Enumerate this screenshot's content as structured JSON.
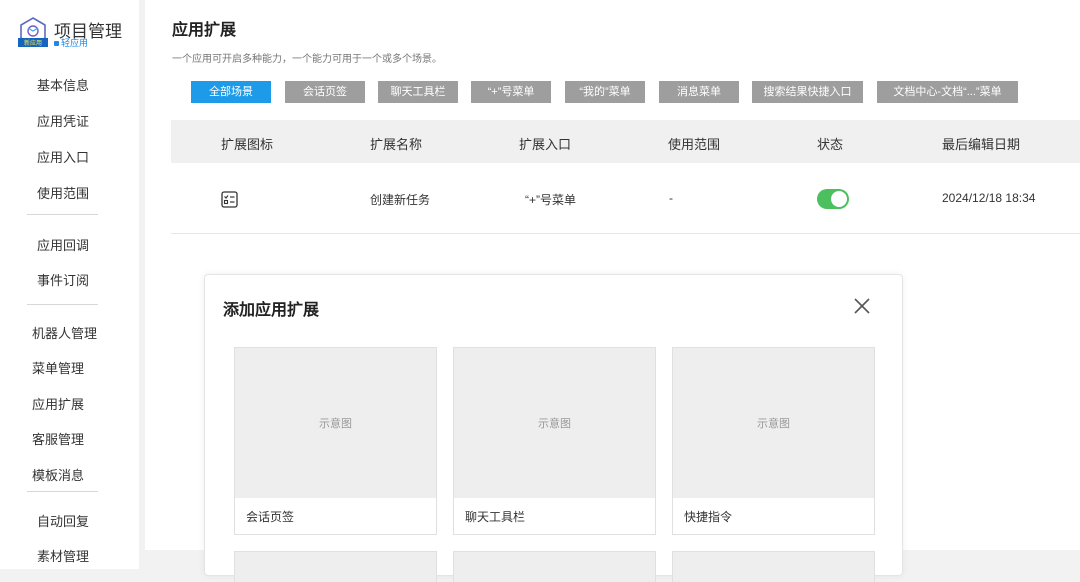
{
  "app": {
    "title": "项目管理",
    "subtitle": "轻应用",
    "logo_text": "新应用"
  },
  "sidebar": {
    "items": [
      {
        "label": "基本信息"
      },
      {
        "label": "应用凭证"
      },
      {
        "label": "应用入口"
      },
      {
        "label": "使用范围"
      },
      {
        "label": "应用回调"
      },
      {
        "label": "事件订阅"
      },
      {
        "label": "机器人管理"
      },
      {
        "label": "菜单管理"
      },
      {
        "label": "应用扩展"
      },
      {
        "label": "客服管理"
      },
      {
        "label": "模板消息"
      },
      {
        "label": "自动回复"
      },
      {
        "label": "素材管理"
      }
    ]
  },
  "main": {
    "title": "应用扩展",
    "description": "一个应用可开启多种能力，一个能力可用于一个或多个场景。",
    "filters": [
      {
        "label": "全部场景",
        "active": true
      },
      {
        "label": "会话页签"
      },
      {
        "label": "聊天工具栏"
      },
      {
        "label": "“+”号菜单"
      },
      {
        "label": "“我的”菜单"
      },
      {
        "label": "消息菜单"
      },
      {
        "label": "搜索结果快捷入口"
      },
      {
        "label": "文档中心-文档“...”菜单"
      }
    ],
    "table": {
      "columns": [
        "扩展图标",
        "扩展名称",
        "扩展入口",
        "使用范围",
        "状态",
        "最后编辑日期"
      ],
      "rows": [
        {
          "icon": "task-list-icon",
          "name": "创建新任务",
          "entry": "“+”号菜单",
          "scope": "-",
          "enabled": true,
          "date": "2024/12/18 18:34"
        }
      ]
    }
  },
  "modal": {
    "title": "添加应用扩展",
    "cards": [
      {
        "preview": "示意图",
        "label": "会话页签"
      },
      {
        "preview": "示意图",
        "label": "聊天工具栏"
      },
      {
        "preview": "示意图",
        "label": "快捷指令"
      }
    ]
  },
  "colors": {
    "accent": "#1e9be8",
    "chip_inactive": "#9e9e9e",
    "toggle_on": "#4cbf5e",
    "background": "#f2f2f2"
  }
}
